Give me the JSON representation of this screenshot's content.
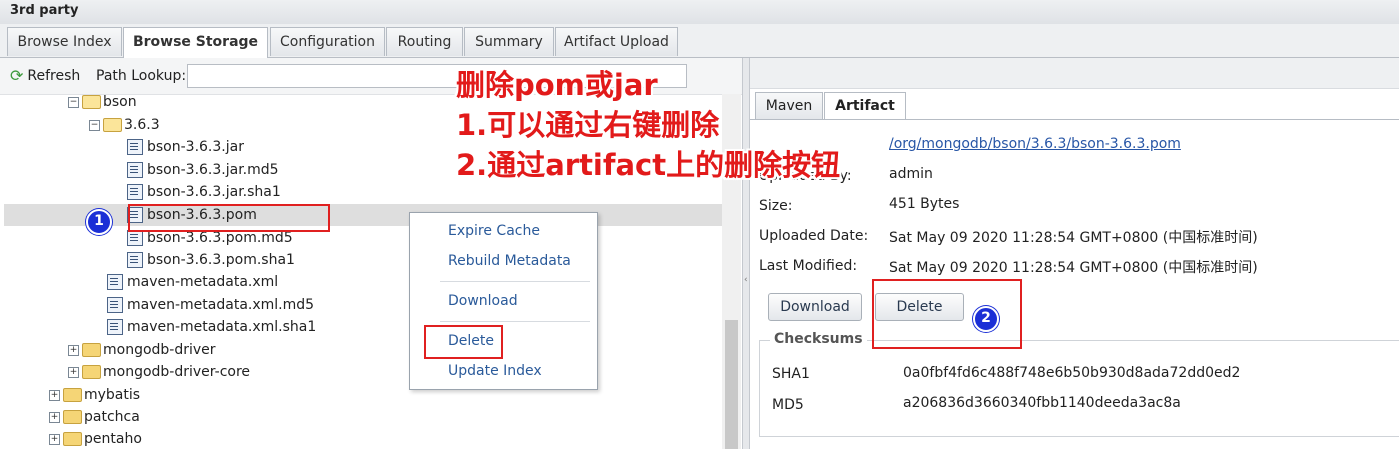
{
  "window_title": "3rd party",
  "tabs": [
    {
      "label": "Browse Index"
    },
    {
      "label": "Browse Storage"
    },
    {
      "label": "Configuration"
    },
    {
      "label": "Routing"
    },
    {
      "label": "Summary"
    },
    {
      "label": "Artifact Upload"
    }
  ],
  "left_toolbar": {
    "refresh_label": "Refresh",
    "path_lookup_label": "Path Lookup:",
    "path_lookup_value": ""
  },
  "tree": [
    {
      "label": "bson",
      "type": "folder",
      "expanded": true
    },
    {
      "label": "3.6.3",
      "type": "folder",
      "expanded": true
    },
    {
      "label": "bson-3.6.3.jar",
      "type": "file"
    },
    {
      "label": "bson-3.6.3.jar.md5",
      "type": "file"
    },
    {
      "label": "bson-3.6.3.jar.sha1",
      "type": "file"
    },
    {
      "label": "bson-3.6.3.pom",
      "type": "file",
      "selected": true
    },
    {
      "label": "bson-3.6.3.pom.md5",
      "type": "file"
    },
    {
      "label": "bson-3.6.3.pom.sha1",
      "type": "file"
    },
    {
      "label": "maven-metadata.xml",
      "type": "file"
    },
    {
      "label": "maven-metadata.xml.md5",
      "type": "file"
    },
    {
      "label": "maven-metadata.xml.sha1",
      "type": "file"
    },
    {
      "label": "mongodb-driver",
      "type": "folder",
      "expanded": false
    },
    {
      "label": "mongodb-driver-core",
      "type": "folder",
      "expanded": false
    },
    {
      "label": "mybatis",
      "type": "folder",
      "expanded": false
    },
    {
      "label": "patchca",
      "type": "folder",
      "expanded": false
    },
    {
      "label": "pentaho",
      "type": "folder",
      "expanded": false
    }
  ],
  "context_menu": [
    {
      "label": "Expire Cache"
    },
    {
      "label": "Rebuild Metadata"
    },
    {
      "label": "Download"
    },
    {
      "label": "Delete"
    },
    {
      "label": "Update Index"
    }
  ],
  "right_tabs": [
    {
      "label": "Maven"
    },
    {
      "label": "Artifact"
    }
  ],
  "artifact": {
    "path": "/org/mongodb/bson/3.6.3/bson-3.6.3.pom",
    "uploaded_by_label": "Uploaded By:",
    "uploaded_by": "admin",
    "size_label": "Size:",
    "size": "451 Bytes",
    "uploaded_date_label": "Uploaded Date:",
    "uploaded_date": "Sat May 09 2020 11:28:54 GMT+0800 (中国标准时间)",
    "last_modified_label": "Last Modified:",
    "last_modified": "Sat May 09 2020 11:28:54 GMT+0800 (中国标准时间)",
    "download_button": "Download",
    "delete_button": "Delete"
  },
  "checksums": {
    "title": "Checksums",
    "sha1_label": "SHA1",
    "sha1": "0a0fbf4fd6c488f748e6b50b930d8ada72dd0ed2",
    "md5_label": "MD5",
    "md5": "a206836d3660340fbb1140deeda3ac8a"
  },
  "annotation": {
    "line1": "删除pom或jar",
    "line2": "1.可以通过右键删除",
    "line3": "2.通过artifact上的删除按钮",
    "badge1": "1",
    "badge2": "2",
    "color": "#e21a1a"
  }
}
